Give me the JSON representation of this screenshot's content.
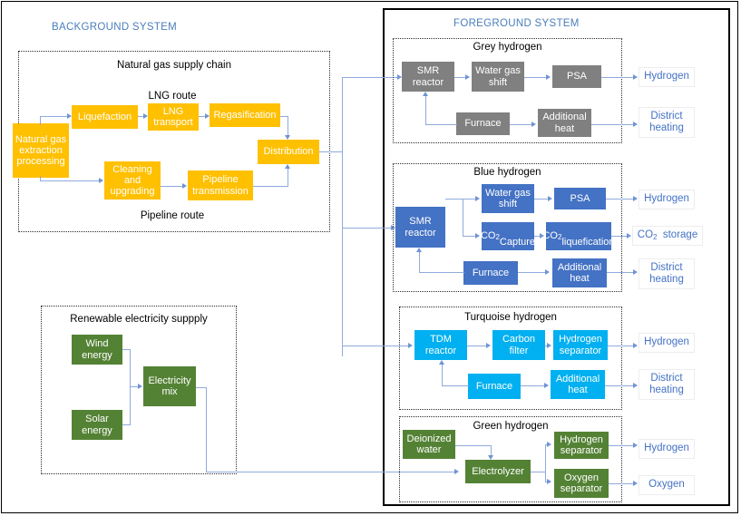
{
  "systems": {
    "background_label": "BACKGROUND SYSTEM",
    "foreground_label": "FOREGROUND SYSTEM"
  },
  "background": {
    "gas_chain": {
      "title": "Natural gas supply chain",
      "lng_route_label": "LNG route",
      "pipeline_route_label": "Pipeline route",
      "nodes": [
        {
          "id": "ng-extraction",
          "label": "Natural gas extraction processing",
          "color": "#FFC000"
        },
        {
          "id": "liquefaction",
          "label": "Liquefaction",
          "color": "#FFC000"
        },
        {
          "id": "lng-transport",
          "label": "LNG transport",
          "color": "#FFC000"
        },
        {
          "id": "regasification",
          "label": "Regasification",
          "color": "#FFC000"
        },
        {
          "id": "cleaning-upgrading",
          "label": "Cleaning and upgrading",
          "color": "#FFC000"
        },
        {
          "id": "pipeline-transmission",
          "label": "Pipeline transmission",
          "color": "#FFC000"
        },
        {
          "id": "distribution",
          "label": "Distribution",
          "color": "#FFC000"
        }
      ]
    },
    "renewable": {
      "title": "Renewable electricity suppply",
      "nodes": [
        {
          "id": "wind-energy",
          "label": "Wind energy",
          "color": "#548235"
        },
        {
          "id": "solar-energy",
          "label": "Solar energy",
          "color": "#548235"
        },
        {
          "id": "electricity-mix",
          "label": "Electricity mix",
          "color": "#548235"
        }
      ]
    }
  },
  "foreground": {
    "grey": {
      "title": "Grey hydrogen",
      "color": "#808080",
      "nodes": [
        {
          "id": "smr-reactor",
          "label": "SMR reactor"
        },
        {
          "id": "water-gas-shift",
          "label": "Water gas shift"
        },
        {
          "id": "psa",
          "label": "PSA"
        },
        {
          "id": "furnace",
          "label": "Furnace"
        },
        {
          "id": "additional-heat",
          "label": "Additional heat"
        }
      ],
      "outputs": [
        {
          "id": "hydrogen",
          "label": "Hydrogen"
        },
        {
          "id": "district-heating",
          "label": "District heating"
        }
      ]
    },
    "blue": {
      "title": "Blue hydrogen",
      "color": "#4472C4",
      "nodes": [
        {
          "id": "smr-reactor",
          "label": "SMR reactor"
        },
        {
          "id": "water-gas-shift",
          "label": "Water gas shift"
        },
        {
          "id": "psa",
          "label": "PSA"
        },
        {
          "id": "co2-capture",
          "label": "CO2 Capture",
          "html": "CO<sub>2</sub><br>Capture"
        },
        {
          "id": "co2-liquefication",
          "label": "CO2 liquefication",
          "html": "CO<sub>2</sub><br>liquefication"
        },
        {
          "id": "furnace",
          "label": "Furnace"
        },
        {
          "id": "additional-heat",
          "label": "Additional heat"
        }
      ],
      "outputs": [
        {
          "id": "hydrogen",
          "label": "Hydrogen"
        },
        {
          "id": "co2-storage",
          "label": "CO2  storage",
          "html": "CO<sub>2</sub>&nbsp; storage"
        },
        {
          "id": "district-heating",
          "label": "District heating"
        }
      ]
    },
    "turquoise": {
      "title": "Turquoise hydrogen",
      "color": "#00B0F0",
      "nodes": [
        {
          "id": "tdm-reactor",
          "label": "TDM reactor"
        },
        {
          "id": "carbon-filter",
          "label": "Carbon filter"
        },
        {
          "id": "hydrogen-separator",
          "label": "Hydrogen separator"
        },
        {
          "id": "furnace",
          "label": "Furnace"
        },
        {
          "id": "additional-heat",
          "label": "Additional heat"
        }
      ],
      "outputs": [
        {
          "id": "hydrogen",
          "label": "Hydrogen"
        },
        {
          "id": "district-heating",
          "label": "District heating"
        }
      ]
    },
    "green": {
      "title": "Green hydrogen",
      "color": "#548235",
      "nodes": [
        {
          "id": "deionized-water",
          "label": "Deionized water"
        },
        {
          "id": "electrolyzer",
          "label": "Electrolyzer"
        },
        {
          "id": "hydrogen-separator",
          "label": "Hydrogen separator"
        },
        {
          "id": "oxygen-separator",
          "label": "Oxygen separator"
        }
      ],
      "outputs": [
        {
          "id": "hydrogen",
          "label": "Hydrogen"
        },
        {
          "id": "oxygen",
          "label": "Oxygen"
        }
      ]
    }
  }
}
